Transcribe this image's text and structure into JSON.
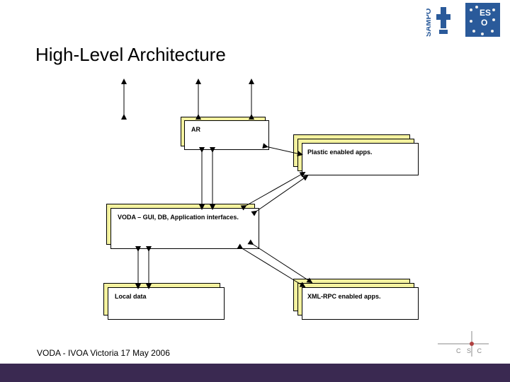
{
  "title": "High-Level Architecture",
  "footer": "VODA -  IVOA Victoria 17 May 2006",
  "logos": {
    "sampo": "SAMPO",
    "eso_top": "ES",
    "eso_bottom": "O",
    "csc": "C S C"
  },
  "boxes": {
    "ar": {
      "label": "AR"
    },
    "plastic": {
      "label": "Plastic enabled apps."
    },
    "voda": {
      "label": "VODA – GUI, DB, Application interfaces."
    },
    "local": {
      "label": "Local data"
    },
    "xmlrpc": {
      "label": "XML-RPC enabled apps."
    }
  }
}
